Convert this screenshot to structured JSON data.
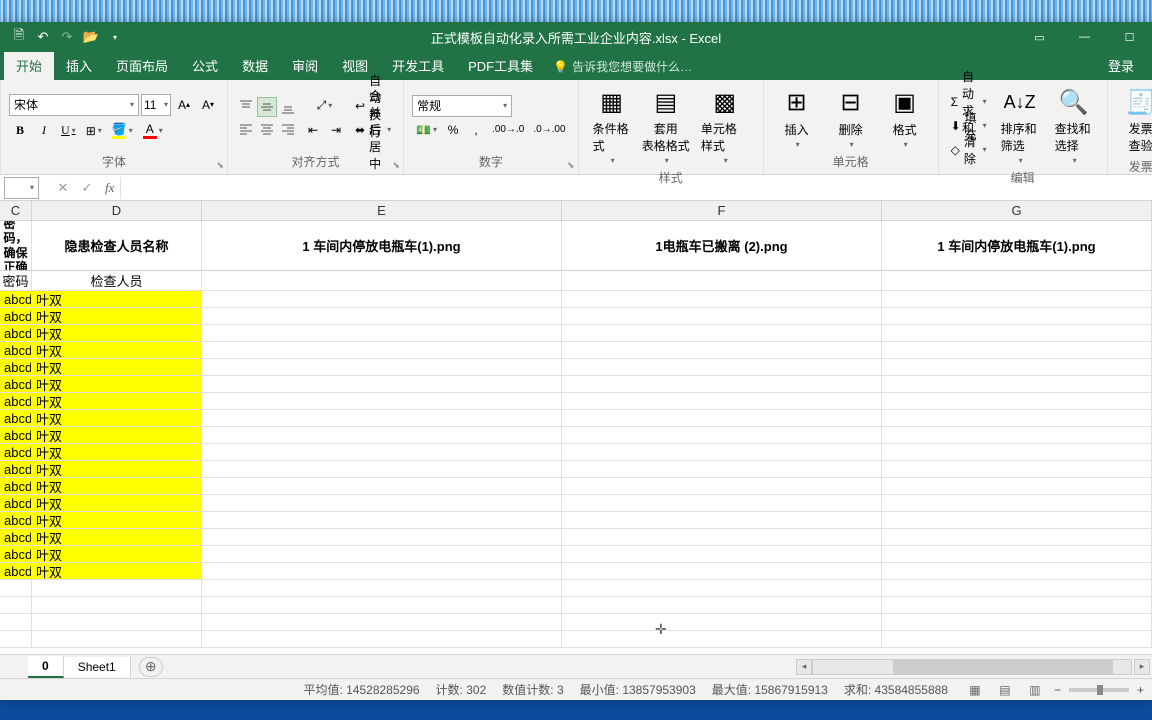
{
  "title": "正式模板自动化录入所需工业企业内容.xlsx - Excel",
  "tabs": [
    "开始",
    "插入",
    "页面布局",
    "公式",
    "数据",
    "审阅",
    "视图",
    "开发工具",
    "PDF工具集"
  ],
  "tell_me": "告诉我您想要做什么…",
  "login": "登录",
  "font": {
    "name": "宋体",
    "size": "11"
  },
  "number_format": "常规",
  "groups": {
    "font": "字体",
    "align": "对齐方式",
    "number": "数字",
    "styles": "样式",
    "cells": "单元格",
    "editing": "编辑",
    "invoice": "发票"
  },
  "ribbon": {
    "wrap": "自动换行",
    "merge": "合并后居中",
    "cond_fmt": "条件格式",
    "table_fmt": "套用\n表格格式",
    "cell_style": "单元格样式",
    "insert": "插入",
    "delete": "删除",
    "format": "格式",
    "autosum": "自动求和",
    "fill": "填充",
    "clear": "清除",
    "sort": "排序和筛选",
    "find": "查找和选择",
    "invoice": "发票\n查验"
  },
  "columns": [
    "C",
    "D",
    "E",
    "F",
    "G"
  ],
  "headers": {
    "C": "密码，确保正确",
    "D": "隐患检查人员名称",
    "E": "1 车间内停放电瓶车(1).png",
    "F": "1电瓶车已搬离 (2).png",
    "G": "1 车间内停放电瓶车(1).png"
  },
  "subheaders": {
    "C": "密码",
    "D": "检查人员"
  },
  "row_c": "abcd",
  "row_d": "叶双",
  "row_count": 17,
  "sheet_tabs": [
    "0",
    "Sheet1"
  ],
  "active_tab": "0",
  "status": {
    "avg_label": "平均值:",
    "avg": "14528285296",
    "count_label": "计数:",
    "count": "302",
    "numcount_label": "数值计数:",
    "numcount": "3",
    "min_label": "最小值:",
    "min": "13857953903",
    "max_label": "最大值:",
    "max": "15867915913",
    "sum_label": "求和:",
    "sum": "43584855888"
  }
}
